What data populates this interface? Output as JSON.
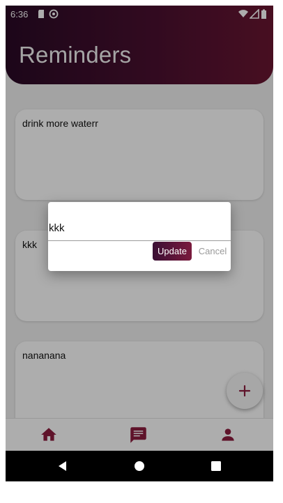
{
  "status_bar": {
    "time": "6:36"
  },
  "header": {
    "title": "Reminders"
  },
  "reminders": [
    {
      "text": "drink more waterr"
    },
    {
      "text": "kkk"
    },
    {
      "text": "nananana"
    }
  ],
  "fab": {
    "icon": "plus-icon"
  },
  "bottom_nav": {
    "items": [
      {
        "icon": "home-icon"
      },
      {
        "icon": "message-icon"
      },
      {
        "icon": "person-icon"
      }
    ]
  },
  "dialog": {
    "input_value": "kkk",
    "update_label": "Update",
    "cancel_label": "Cancel"
  },
  "colors": {
    "accent": "#8c1d3f",
    "header_start": "#2a0a26",
    "header_end": "#6a1632"
  }
}
